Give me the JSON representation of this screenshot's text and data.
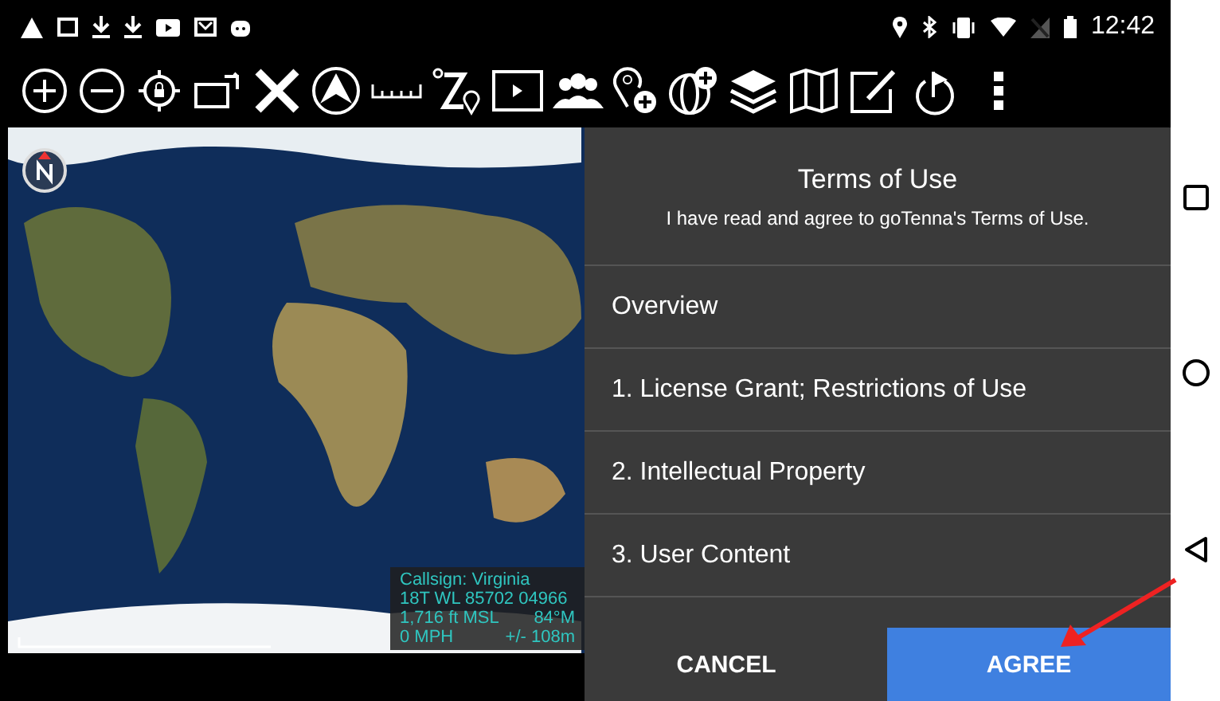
{
  "status_bar": {
    "time": "12:42"
  },
  "map": {
    "info": {
      "callsign": "Callsign: Virginia",
      "grid": "18T WL 85702 04966",
      "altitude": "1,716 ft MSL",
      "heading": "84°M",
      "speed": "0 MPH",
      "accuracy": "+/- 108m"
    }
  },
  "dialog": {
    "title": "Terms of Use",
    "subtitle": "I have read and agree to goTenna's Terms of Use.",
    "items": [
      "Overview",
      "1. License Grant; Restrictions of Use",
      "2. Intellectual Property",
      "3. User Content"
    ],
    "buttons": [
      {
        "label": "CANCEL",
        "kind": "secondary"
      },
      {
        "label": "AGREE",
        "kind": "primary"
      }
    ]
  }
}
